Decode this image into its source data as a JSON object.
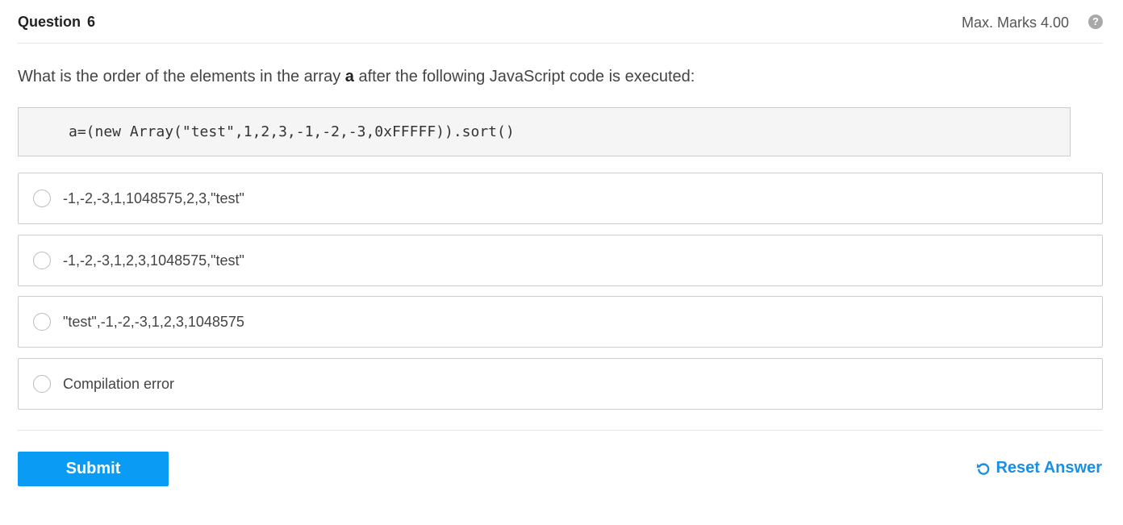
{
  "header": {
    "question_label": "Question",
    "question_number": "6",
    "max_marks": "Max. Marks 4.00",
    "help_icon": "question-circle-icon"
  },
  "question": {
    "text_before": "What is the order of the elements in the array ",
    "text_bold": "a",
    "text_after": " after the following JavaScript code is executed:",
    "code": "a=(new Array(\"test\",1,2,3,-1,-2,-3,0xFFFFF)).sort()"
  },
  "options": [
    {
      "label": "-1,-2,-3,1,1048575,2,3,\"test\""
    },
    {
      "label": "-1,-2,-3,1,2,3,1048575,\"test\""
    },
    {
      "label": "\"test\",-1,-2,-3,1,2,3,1048575"
    },
    {
      "label": "Compilation error"
    }
  ],
  "actions": {
    "submit_label": "Submit",
    "reset_label": "Reset Answer",
    "reset_icon": "undo-icon"
  },
  "colors": {
    "accent": "#0a9bf5",
    "link": "#1a8fe3"
  }
}
